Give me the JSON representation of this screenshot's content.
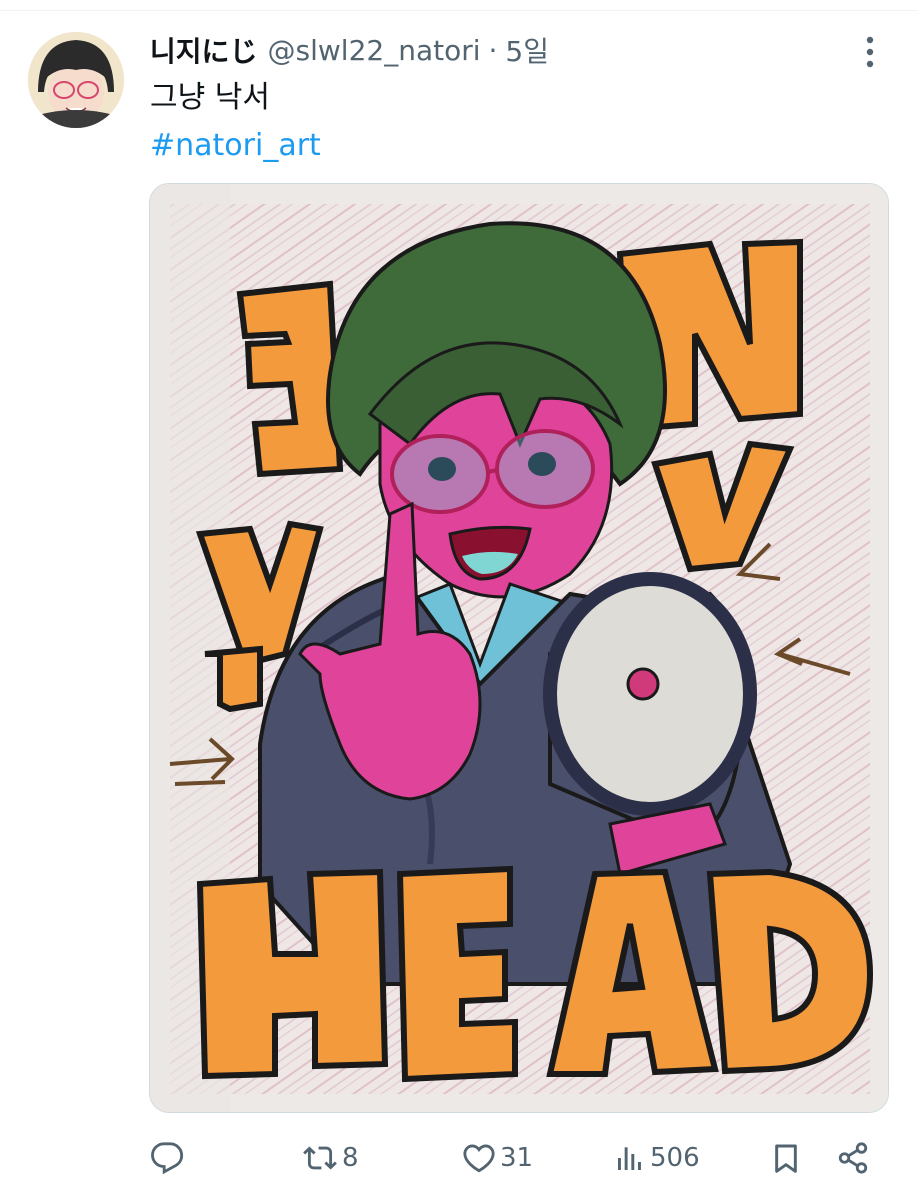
{
  "tweet": {
    "display_name": "니지にじ",
    "handle": "@slwl22_natori",
    "separator": "·",
    "time": "5일",
    "text": "그냥 낙서",
    "hashtag": "#natori_art",
    "media": {
      "description_icon": "drawing-image",
      "art_text_top": "NVY",
      "art_text_bottom": "HEAD"
    }
  },
  "actions": {
    "reply": {
      "icon": "reply-icon"
    },
    "retweet": {
      "icon": "retweet-icon",
      "count": "8"
    },
    "like": {
      "icon": "heart-icon",
      "count": "31"
    },
    "views": {
      "icon": "views-icon",
      "count": "506"
    },
    "bookmark": {
      "icon": "bookmark-icon"
    },
    "share": {
      "icon": "share-icon"
    }
  },
  "colors": {
    "text_primary": "#0f1419",
    "text_secondary": "#536471",
    "link": "#1d9bf0",
    "divider": "#eff3f4"
  }
}
